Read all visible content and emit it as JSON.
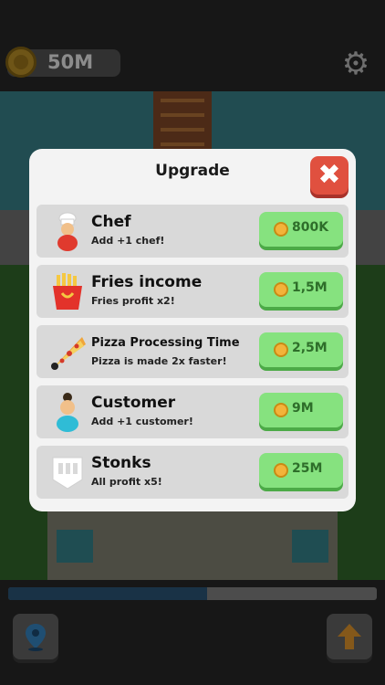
{
  "hud": {
    "coins": "50M",
    "progress_fraction": 0.54
  },
  "modal": {
    "title": "Upgrade",
    "close_symbol": "✖",
    "items": [
      {
        "title": "Chef",
        "desc": "Add +1 chef!",
        "price": "800K",
        "icon": "chef-icon"
      },
      {
        "title": "Fries income",
        "desc": "Fries profit x2!",
        "price": "1,5M",
        "icon": "fries-icon"
      },
      {
        "title": "Pizza Processing Time",
        "desc": "Pizza is made 2x faster!",
        "price": "2,5M",
        "icon": "pizza-icon"
      },
      {
        "title": "Customer",
        "desc": "Add +1 customer!",
        "price": "9M",
        "icon": "customer-icon"
      },
      {
        "title": "Stonks",
        "desc": "All profit x5!",
        "price": "25M",
        "icon": "stonks-icon"
      }
    ]
  },
  "colors": {
    "buy": "#86e27f",
    "close": "#e0503f",
    "panel": "#f3f3f3",
    "progress": "#2e5c80"
  }
}
